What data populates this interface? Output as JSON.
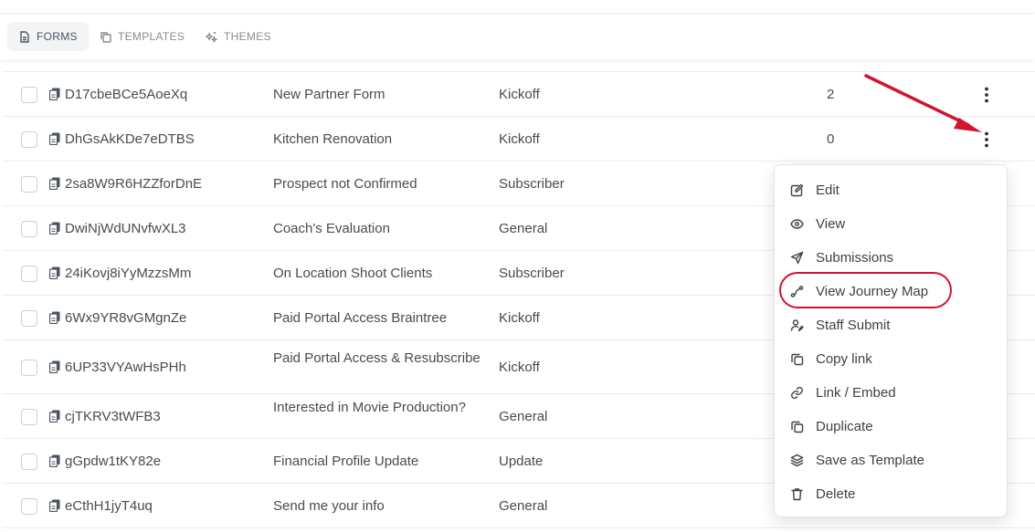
{
  "tabs": [
    {
      "label": "FORMS",
      "icon": "document-icon",
      "active": true
    },
    {
      "label": "TEMPLATES",
      "icon": "copy-icon",
      "active": false
    },
    {
      "label": "THEMES",
      "icon": "sparkle-icon",
      "active": false
    }
  ],
  "rows": [
    {
      "id": "D17cbeBCe5AoeXq",
      "name": "New Partner Form",
      "type": "Kickoff",
      "count": "2"
    },
    {
      "id": "DhGsAkKDe7eDTBS",
      "name": "Kitchen Renovation",
      "type": "Kickoff",
      "count": "0"
    },
    {
      "id": "2sa8W9R6HZZforDnE",
      "name": "Prospect not Confirmed",
      "type": "Subscriber",
      "count": ""
    },
    {
      "id": "DwiNjWdUNvfwXL3",
      "name": "Coach's Evaluation",
      "type": "General",
      "count": ""
    },
    {
      "id": "24iKovj8iYyMzzsMm",
      "name": "On Location Shoot Clients",
      "type": "Subscriber",
      "count": ""
    },
    {
      "id": "6Wx9YR8vGMgnZe",
      "name": "Paid Portal Access Braintree",
      "type": "Kickoff",
      "count": ""
    },
    {
      "id": "6UP33VYAwHsPHh",
      "name": "Paid Portal Access & Resubscribe",
      "type": "Kickoff",
      "count": ""
    },
    {
      "id": "cjTKRV3tWFB3",
      "name": "Interested in Movie Production?",
      "type": "General",
      "count": ""
    },
    {
      "id": "gGpdw1tKY82e",
      "name": "Financial Profile Update",
      "type": "Update",
      "count": ""
    },
    {
      "id": "eCthH1jyT4uq",
      "name": "Send me your info",
      "type": "General",
      "count": ""
    }
  ],
  "menu": {
    "items": [
      {
        "label": "Edit",
        "icon": "edit-icon"
      },
      {
        "label": "View",
        "icon": "eye-icon"
      },
      {
        "label": "Submissions",
        "icon": "send-icon"
      },
      {
        "label": "View Journey Map",
        "icon": "route-icon"
      },
      {
        "label": "Staff Submit",
        "icon": "user-icon"
      },
      {
        "label": "Copy link",
        "icon": "copy-icon"
      },
      {
        "label": "Link / Embed",
        "icon": "link-icon"
      },
      {
        "label": "Duplicate",
        "icon": "duplicate-icon"
      },
      {
        "label": "Save as Template",
        "icon": "layers-icon"
      },
      {
        "label": "Delete",
        "icon": "trash-icon"
      }
    ]
  },
  "colors": {
    "annotation": "#d1132f",
    "text": "#3f3f46",
    "border": "#ebebeb"
  }
}
